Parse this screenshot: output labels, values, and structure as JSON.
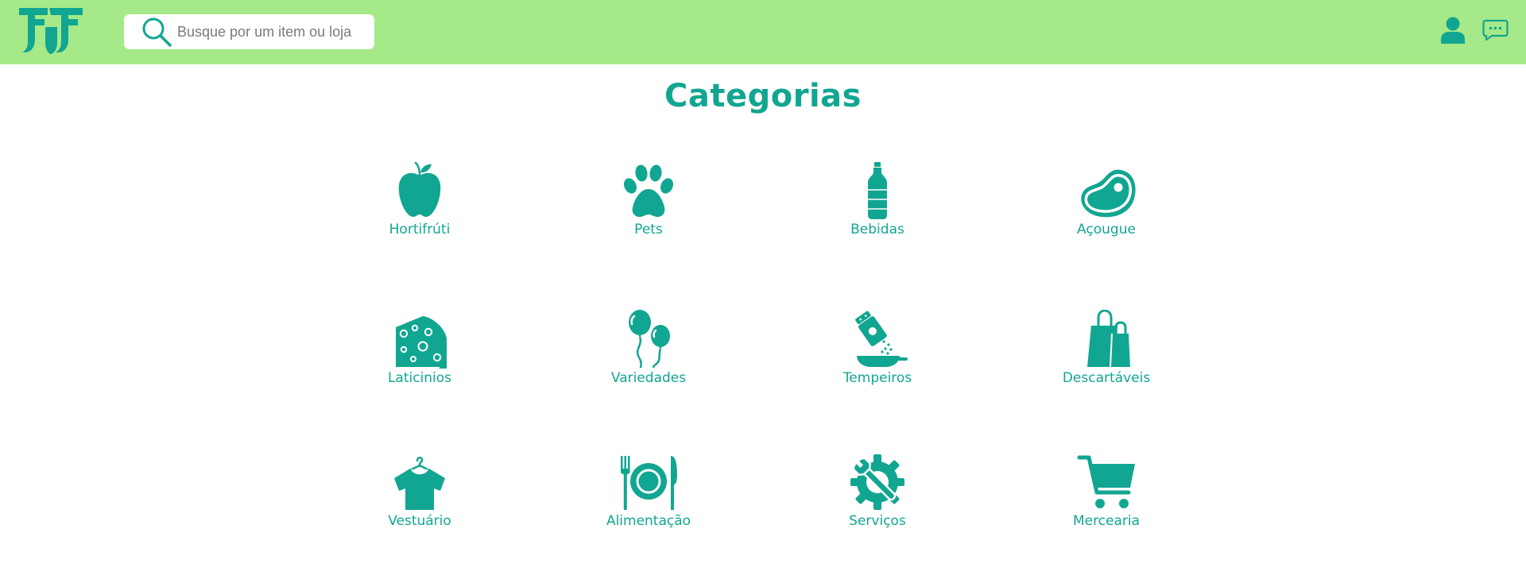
{
  "colors": {
    "topbar": "#a6e988",
    "accent": "#11a691",
    "background": "#ffffff"
  },
  "header": {
    "logo_icon": "ff-logo-icon",
    "search": {
      "placeholder": "Busque por um item ou loja",
      "value": "",
      "icon": "search-icon"
    },
    "user_icon": "user-icon",
    "chat_icon": "chat-bubble-icon"
  },
  "main": {
    "title": "Categorias",
    "categories": [
      {
        "label": "Hortifrúti",
        "icon": "apple-icon"
      },
      {
        "label": "Pets",
        "icon": "paw-icon"
      },
      {
        "label": "Bebidas",
        "icon": "bottle-icon"
      },
      {
        "label": "Açougue",
        "icon": "steak-icon"
      },
      {
        "label": "Laticinios",
        "icon": "cheese-icon"
      },
      {
        "label": "Variedades",
        "icon": "balloons-icon"
      },
      {
        "label": "Tempeiros",
        "icon": "salt-shaker-icon"
      },
      {
        "label": "Descartáveis",
        "icon": "shopping-bags-icon"
      },
      {
        "label": "Vestuário",
        "icon": "shirt-hanger-icon"
      },
      {
        "label": "Alimentação",
        "icon": "plate-cutlery-icon"
      },
      {
        "label": "Serviços",
        "icon": "gear-wrench-icon"
      },
      {
        "label": "Mercearia",
        "icon": "cart-icon"
      }
    ]
  }
}
